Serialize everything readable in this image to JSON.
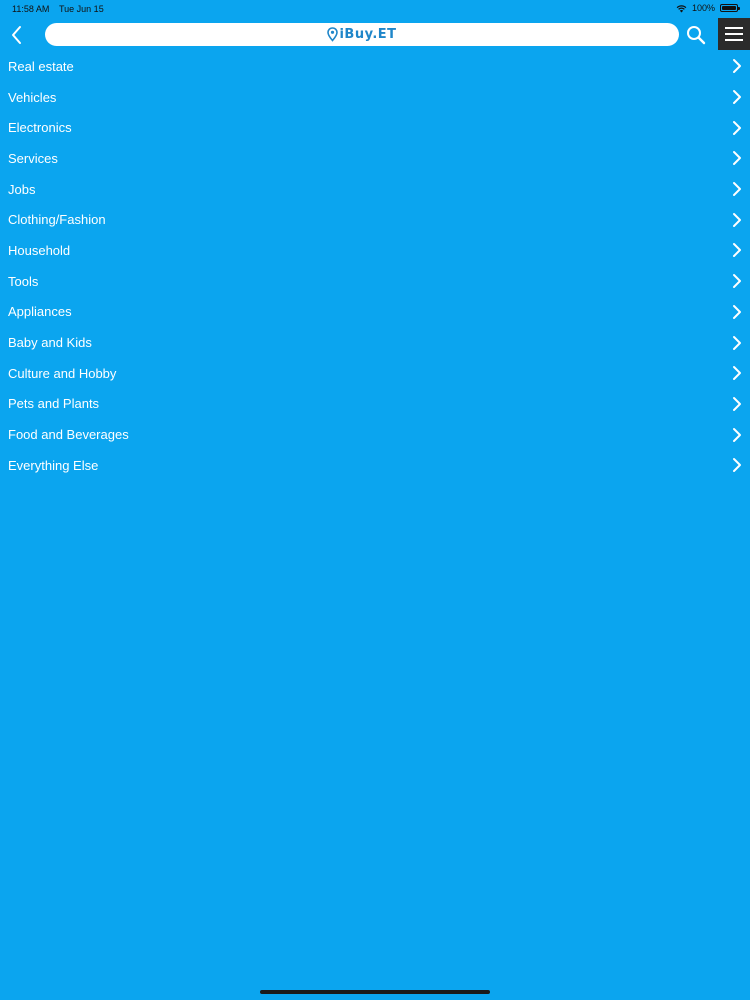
{
  "status_bar": {
    "time": "11:58 AM",
    "date": "Tue Jun 15",
    "battery": "100%",
    "wifi_icon": "wifi-icon",
    "battery_icon": "battery-icon"
  },
  "nav": {
    "back_icon": "chevron-left-icon",
    "logo_text": "iBuy.ET",
    "logo_icon": "location-pin-icon",
    "search_icon": "search-icon",
    "menu_icon": "hamburger-menu-icon"
  },
  "colors": {
    "background": "#0ba5ef",
    "logo_blue": "#1f86c9",
    "menu_button_bg": "#2b2b2b",
    "text": "#ffffff"
  },
  "categories": [
    {
      "label": "Real estate"
    },
    {
      "label": "Vehicles"
    },
    {
      "label": "Electronics"
    },
    {
      "label": "Services"
    },
    {
      "label": "Jobs"
    },
    {
      "label": "Clothing/Fashion"
    },
    {
      "label": "Household"
    },
    {
      "label": "Tools"
    },
    {
      "label": "Appliances"
    },
    {
      "label": "Baby and Kids"
    },
    {
      "label": "Culture and Hobby"
    },
    {
      "label": "Pets and Plants"
    },
    {
      "label": "Food and Beverages"
    },
    {
      "label": "Everything Else"
    }
  ]
}
